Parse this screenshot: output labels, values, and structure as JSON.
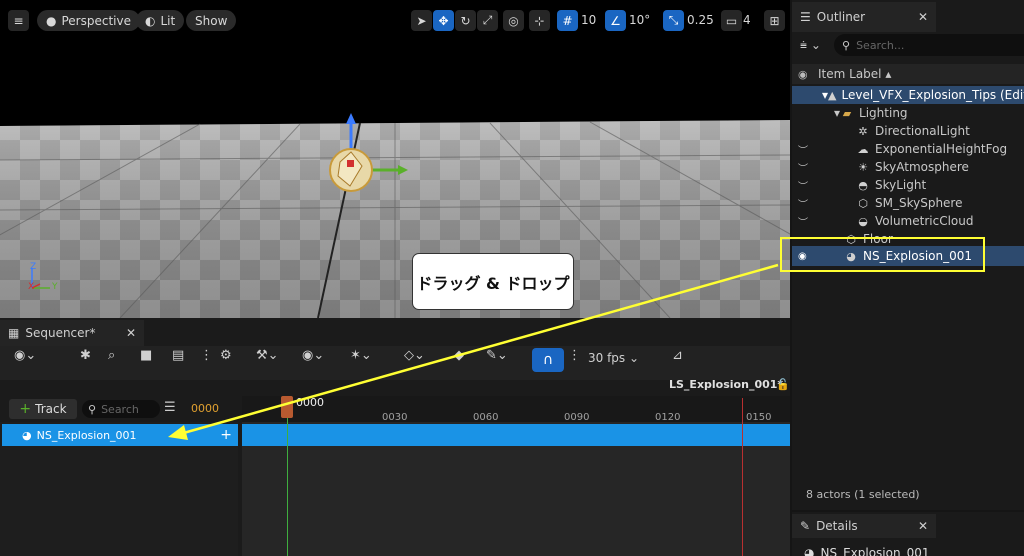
{
  "viewport": {
    "perspective_label": "Perspective",
    "lit_label": "Lit",
    "show_label": "Show",
    "grid_snap_value": "10",
    "rotation_snap_value": "10°",
    "scale_snap_value": "0.25",
    "camera_speed_value": "4",
    "axis_z": "Z",
    "axis_x": "X",
    "axis_y": "Y",
    "callout_text": "ドラッグ & ドロップ"
  },
  "outliner": {
    "tab_title": "Outliner",
    "search_placeholder": "Search...",
    "column_header": "Item Label ▴",
    "items": [
      {
        "label": "Level_VFX_Explosion_Tips (Editor)"
      },
      {
        "label": "Lighting"
      },
      {
        "label": "DirectionalLight"
      },
      {
        "label": "ExponentialHeightFog"
      },
      {
        "label": "SkyAtmosphere"
      },
      {
        "label": "SkyLight"
      },
      {
        "label": "SM_SkySphere"
      },
      {
        "label": "VolumetricCloud"
      },
      {
        "label": "Floor"
      },
      {
        "label": "NS_Explosion_001"
      }
    ],
    "footer": "8 actors (1 selected)"
  },
  "sequencer": {
    "tab_title": "Sequencer*",
    "fps_label": "30 fps",
    "sequence_name": "LS_Explosion_001*",
    "add_track_label": "Track",
    "search_placeholder": "Search",
    "current_frame": "0000",
    "playhead_frame": "0000",
    "ruler_labels": [
      "0030",
      "0060",
      "0090",
      "0120",
      "0150"
    ],
    "track_name": "NS_Explosion_001"
  },
  "details": {
    "tab_title": "Details",
    "selected_name": "NS_Explosion_001"
  },
  "colors": {
    "accent": "#1a66c2",
    "selection": "#2d4a6e",
    "track": "#1a93e6",
    "highlight": "#ffff33"
  }
}
